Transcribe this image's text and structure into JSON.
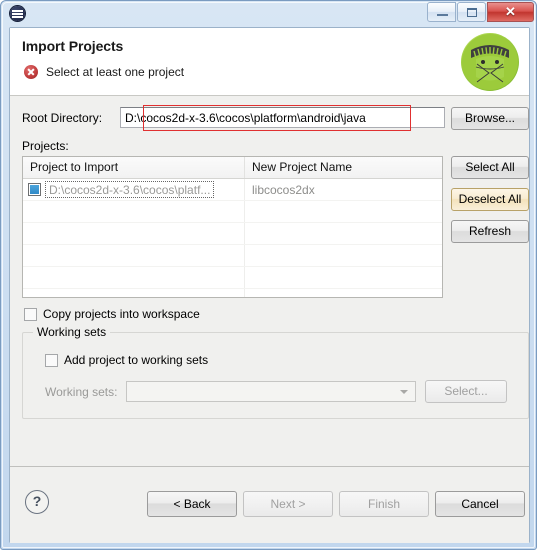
{
  "window": {
    "app_icon": "eclipse-icon",
    "controls": {
      "minimize": "minimize-icon",
      "maximize": "maximize-icon",
      "close_label": "✕"
    }
  },
  "header": {
    "title": "Import Projects",
    "message": "Select at least one project",
    "message_icon": "error-icon",
    "brand_icon": "android-robot-icon"
  },
  "root_directory": {
    "label": "Root Directory:",
    "value": "D:\\cocos2d-x-3.6\\cocos\\platform\\android\\java",
    "placeholder": "",
    "highlight_color": "#e03030",
    "browse_label": "Browse..."
  },
  "projects": {
    "label": "Projects:",
    "columns": [
      "Project to Import",
      "New Project Name"
    ],
    "rows": [
      {
        "checked": true,
        "project_to_import": "D:\\cocos2d-x-3.6\\cocos\\platf...",
        "new_project_name": "libcocos2dx"
      }
    ],
    "buttons": {
      "select_all": "Select All",
      "deselect_all": "Deselect All",
      "refresh": "Refresh"
    }
  },
  "options": {
    "copy_projects": {
      "label": "Copy projects into workspace",
      "checked": false
    }
  },
  "working_sets": {
    "group_title": "Working sets",
    "add_project": {
      "label": "Add project to working sets",
      "checked": false
    },
    "combo_label": "Working sets:",
    "combo_value": "",
    "select_label": "Select..."
  },
  "footer": {
    "help_label": "?",
    "back_label": "< Back",
    "next_label": "Next >",
    "finish_label": "Finish",
    "cancel_label": "Cancel"
  }
}
